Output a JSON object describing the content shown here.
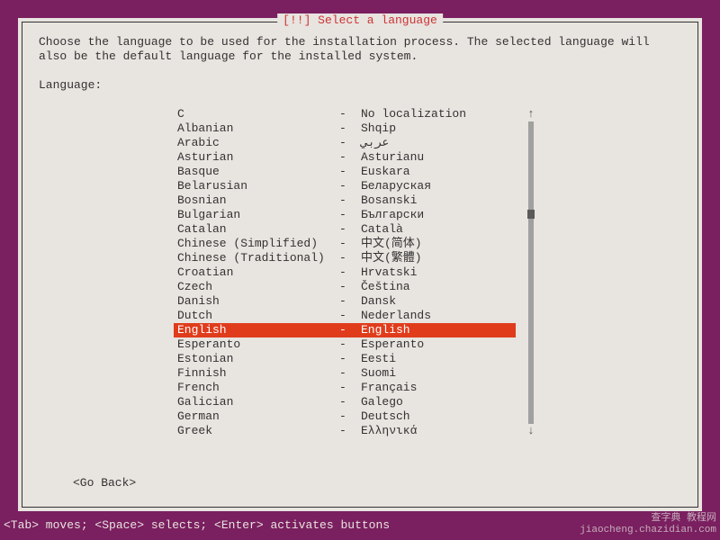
{
  "dialog": {
    "title": "[!!] Select a language",
    "description": "Choose the language to be used for the installation process. The selected language will\nalso be the default language for the installed system.",
    "prompt": "Language:",
    "go_back": "<Go Back>"
  },
  "languages": [
    {
      "name": "C",
      "native": "No localization"
    },
    {
      "name": "Albanian",
      "native": "Shqip"
    },
    {
      "name": "Arabic",
      "native": "عربي"
    },
    {
      "name": "Asturian",
      "native": "Asturianu"
    },
    {
      "name": "Basque",
      "native": "Euskara"
    },
    {
      "name": "Belarusian",
      "native": "Беларуская"
    },
    {
      "name": "Bosnian",
      "native": "Bosanski"
    },
    {
      "name": "Bulgarian",
      "native": "Български"
    },
    {
      "name": "Catalan",
      "native": "Català"
    },
    {
      "name": "Chinese (Simplified)",
      "native": "中文(简体)"
    },
    {
      "name": "Chinese (Traditional)",
      "native": "中文(繁體)"
    },
    {
      "name": "Croatian",
      "native": "Hrvatski"
    },
    {
      "name": "Czech",
      "native": "Čeština"
    },
    {
      "name": "Danish",
      "native": "Dansk"
    },
    {
      "name": "Dutch",
      "native": "Nederlands"
    },
    {
      "name": "English",
      "native": "English"
    },
    {
      "name": "Esperanto",
      "native": "Esperanto"
    },
    {
      "name": "Estonian",
      "native": "Eesti"
    },
    {
      "name": "Finnish",
      "native": "Suomi"
    },
    {
      "name": "French",
      "native": "Français"
    },
    {
      "name": "Galician",
      "native": "Galego"
    },
    {
      "name": "German",
      "native": "Deutsch"
    },
    {
      "name": "Greek",
      "native": "Ελληνικά"
    }
  ],
  "separator": "-",
  "selected_index": 15,
  "scroll": {
    "up_arrow": "↑",
    "down_arrow": "↓"
  },
  "footer": "<Tab> moves; <Space> selects; <Enter> activates buttons",
  "watermark": {
    "line1": "查字典 教程网",
    "line2": "jiaocheng.chazidian.com"
  }
}
